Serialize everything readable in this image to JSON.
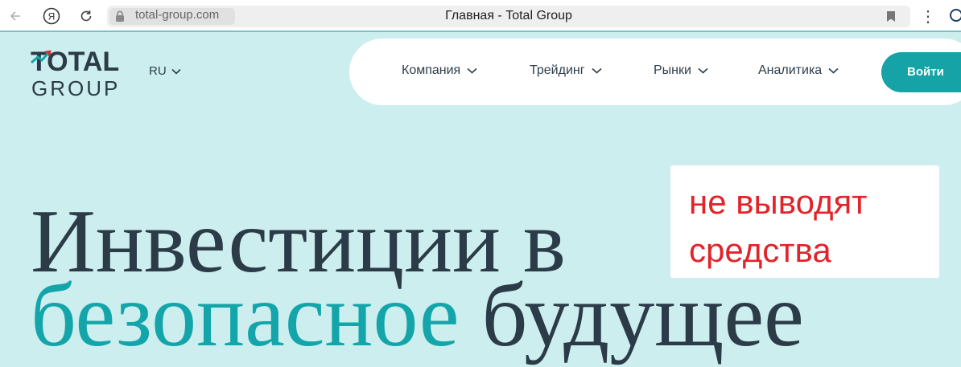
{
  "browser": {
    "url": "total-group.com",
    "page_title": "Главная - Total Group"
  },
  "brand": {
    "name_line1": "TOTAL",
    "name_line2": "GROUP"
  },
  "language": {
    "label": "RU"
  },
  "nav": {
    "items": [
      {
        "label": "Компания"
      },
      {
        "label": "Трейдинг"
      },
      {
        "label": "Рынки"
      },
      {
        "label": "Аналитика"
      }
    ],
    "login_label": "Войти"
  },
  "note": {
    "line1": "не выводят",
    "line2": "средства"
  },
  "hero": {
    "line1": "Инвестиции в",
    "line2_highlight": "безопасное",
    "line2_rest": " будущее"
  },
  "colors": {
    "background": "#cdeeee",
    "accent": "#13a5aa",
    "button": "#15a3a8",
    "heading": "#2b3b48",
    "note_text": "#e1242b"
  }
}
